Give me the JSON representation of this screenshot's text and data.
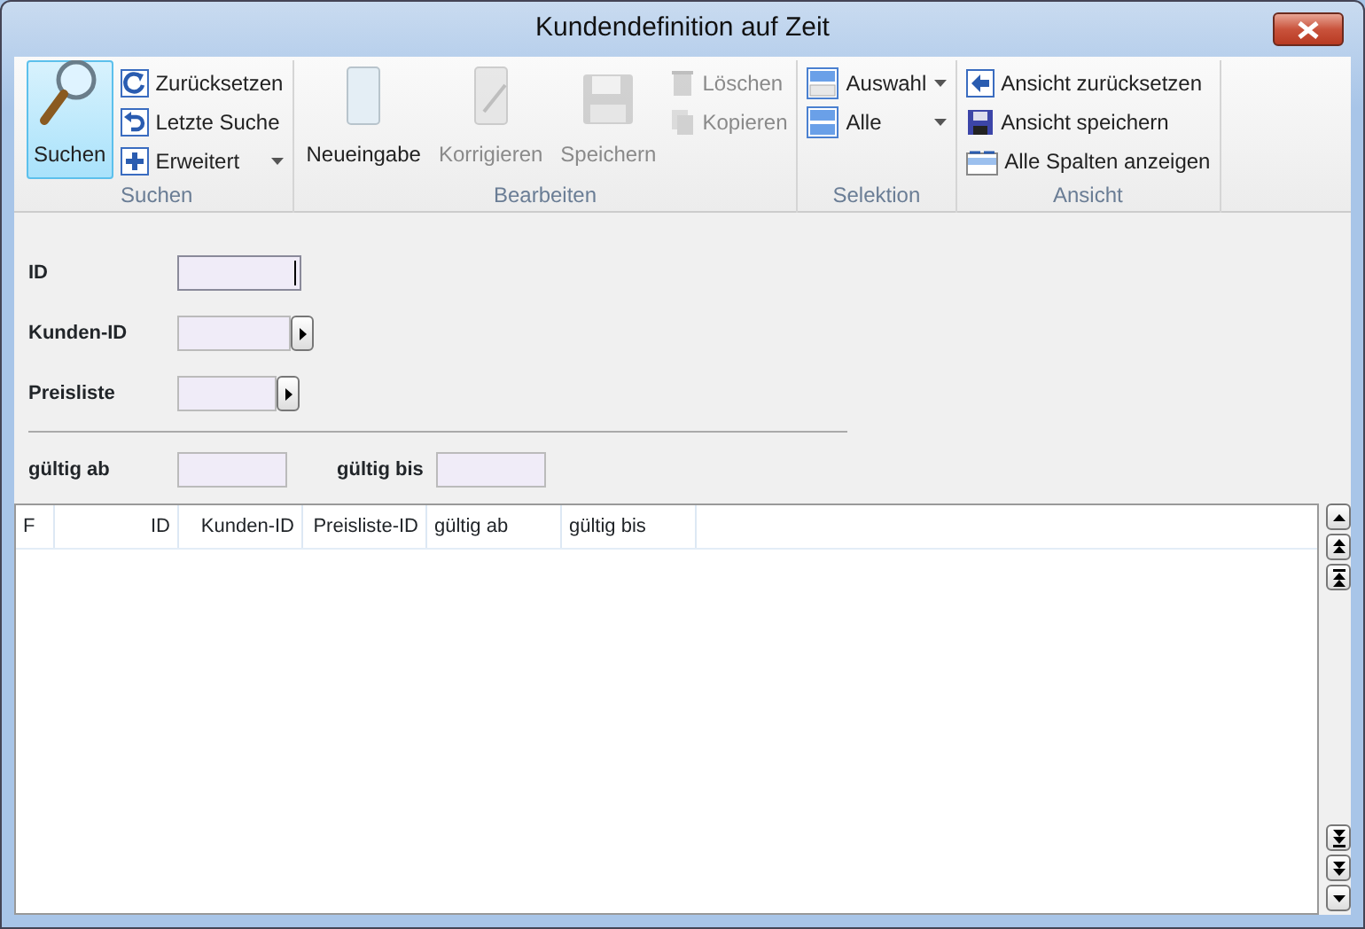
{
  "window": {
    "title": "Kundendefinition auf Zeit"
  },
  "ribbon": {
    "groups": [
      {
        "label": "Suchen",
        "items": [
          {
            "kind": "large",
            "label": "Suchen",
            "selected": true,
            "disabled": false
          },
          {
            "kind": "small",
            "label": "Zurücksetzen",
            "selected": false,
            "disabled": false
          },
          {
            "kind": "small",
            "label": "Letzte Suche",
            "selected": false,
            "disabled": false
          },
          {
            "kind": "small",
            "label": "Erweitert",
            "selected": false,
            "disabled": false,
            "dropdown": true
          }
        ]
      },
      {
        "label": "Bearbeiten",
        "items": [
          {
            "kind": "large",
            "label": "Neueingabe",
            "selected": false,
            "disabled": false
          },
          {
            "kind": "large",
            "label": "Korrigieren",
            "selected": false,
            "disabled": true
          },
          {
            "kind": "large",
            "label": "Speichern",
            "selected": false,
            "disabled": true
          },
          {
            "kind": "small",
            "label": "Löschen",
            "selected": false,
            "disabled": true
          },
          {
            "kind": "small",
            "label": "Kopieren",
            "selected": false,
            "disabled": true
          }
        ]
      },
      {
        "label": "Selektion",
        "items": [
          {
            "kind": "small",
            "label": "Auswahl",
            "selected": false,
            "disabled": false,
            "dropdown": true
          },
          {
            "kind": "small",
            "label": "Alle",
            "selected": false,
            "disabled": false,
            "dropdown": true
          }
        ]
      },
      {
        "label": "Ansicht",
        "items": [
          {
            "kind": "small",
            "label": "Ansicht zurücksetzen",
            "selected": false,
            "disabled": false
          },
          {
            "kind": "small",
            "label": "Ansicht speichern",
            "selected": false,
            "disabled": false
          },
          {
            "kind": "small",
            "label": "Alle Spalten anzeigen",
            "selected": false,
            "disabled": false
          }
        ]
      }
    ]
  },
  "form": {
    "fields": [
      {
        "label": "ID",
        "focused": true
      },
      {
        "label": "Kunden-ID",
        "lookup": true,
        "focused": false
      },
      {
        "label": "Preisliste",
        "lookup": true,
        "focused": false
      }
    ],
    "range": [
      {
        "label": "gültig ab",
        "focused": false
      },
      {
        "label": "gültig bis",
        "focused": false
      }
    ]
  },
  "table": {
    "columns": [
      {
        "label": "F",
        "kind": "text"
      },
      {
        "label": "ID",
        "kind": "number"
      },
      {
        "label": "Kunden-ID",
        "kind": "number"
      },
      {
        "label": "Preisliste-ID",
        "kind": "number"
      },
      {
        "label": "gültig ab",
        "kind": "text"
      },
      {
        "label": "gültig bis",
        "kind": "text"
      }
    ]
  }
}
